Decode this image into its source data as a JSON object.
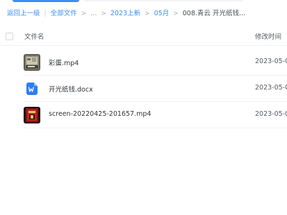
{
  "breadcrumb": {
    "back": "返回上一级",
    "all_files": "全部文件",
    "ellipsis": "...",
    "level1": "2023上新",
    "level2": "05月",
    "current": "008.青云 开光纸钱..."
  },
  "table": {
    "col_name": "文件名",
    "col_modified": "修改时间"
  },
  "files": [
    {
      "name": "彩蛋.mp4",
      "modified": "2023-05-0",
      "icon": "video-thumbnail-icon"
    },
    {
      "name": "开光纸钱.docx",
      "modified": "2023-05-0",
      "icon": "word-doc-icon"
    },
    {
      "name": "screen-20220425-201657.mp4",
      "modified": "2023-05-0",
      "icon": "video-thumbnail-icon"
    }
  ],
  "colors": {
    "accent": "#3a8ef6",
    "word_icon": "#2f7cf6"
  }
}
